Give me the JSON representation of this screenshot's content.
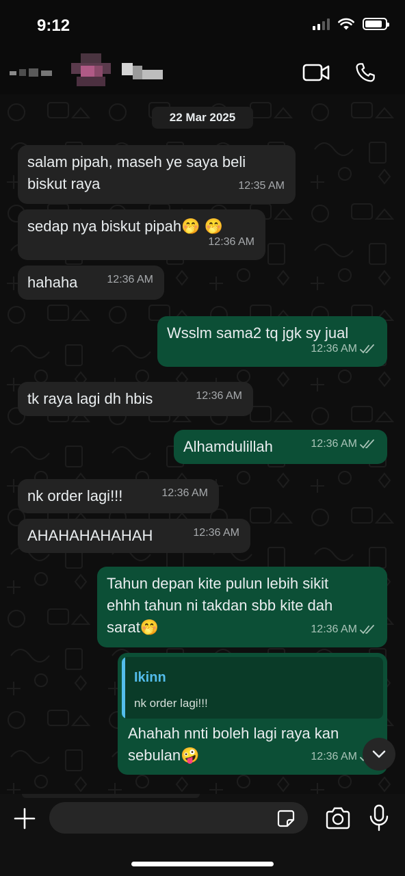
{
  "status_bar": {
    "time": "9:12",
    "battery_level": 0.85
  },
  "header": {
    "icons": {
      "video_call": "video-camera-icon",
      "voice_call": "phone-icon"
    }
  },
  "chat": {
    "date_chip": "22 Mar 2025",
    "messages": [
      {
        "direction": "in",
        "lines": [
          "salam pipah, maseh ye saya beli",
          "biskut raya"
        ],
        "time": "12:35 AM"
      },
      {
        "direction": "in",
        "lines": [
          "sedap nya biskut pipah🤭 🤭"
        ],
        "time": "12:36 AM"
      },
      {
        "direction": "in",
        "lines": [
          "hahaha"
        ],
        "time": "12:36 AM"
      },
      {
        "direction": "out",
        "lines": [
          "Wsslm sama2 tq jgk sy jual"
        ],
        "time": "12:36 AM",
        "status": "read"
      },
      {
        "direction": "in",
        "lines": [
          "tk raya lagi dh hbis"
        ],
        "time": "12:36 AM"
      },
      {
        "direction": "out",
        "lines": [
          "Alhamdulillah"
        ],
        "time": "12:36 AM",
        "status": "read"
      },
      {
        "direction": "in",
        "lines": [
          "nk order lagi!!!"
        ],
        "time": "12:36 AM"
      },
      {
        "direction": "in",
        "lines": [
          "AHAHAHAHAHAH"
        ],
        "time": "12:36 AM"
      },
      {
        "direction": "out",
        "lines": [
          "Tahun depan kite pulun lebih sikit",
          "ehhh tahun ni takdan sbb kite dah",
          "sarat🤭"
        ],
        "time": "12:36 AM",
        "status": "read"
      },
      {
        "direction": "out",
        "reply_to": {
          "name": "Ikinn",
          "text": "nk order lagi!!!"
        },
        "lines": [
          "Ahahah nnti boleh lagi raya kan",
          "sebulan🤪"
        ],
        "time": "12:36 AM",
        "status": "read"
      }
    ]
  },
  "composer": {
    "placeholder": "",
    "icons": {
      "attach": "plus-icon",
      "sticker": "sticker-icon",
      "camera": "camera-icon",
      "mic": "microphone-icon"
    }
  },
  "colors": {
    "incoming_bubble": "#232323",
    "outgoing_bubble": "#0c4f36",
    "reply_accent": "#53bdeb",
    "read_tick": "#a9c4b8"
  }
}
